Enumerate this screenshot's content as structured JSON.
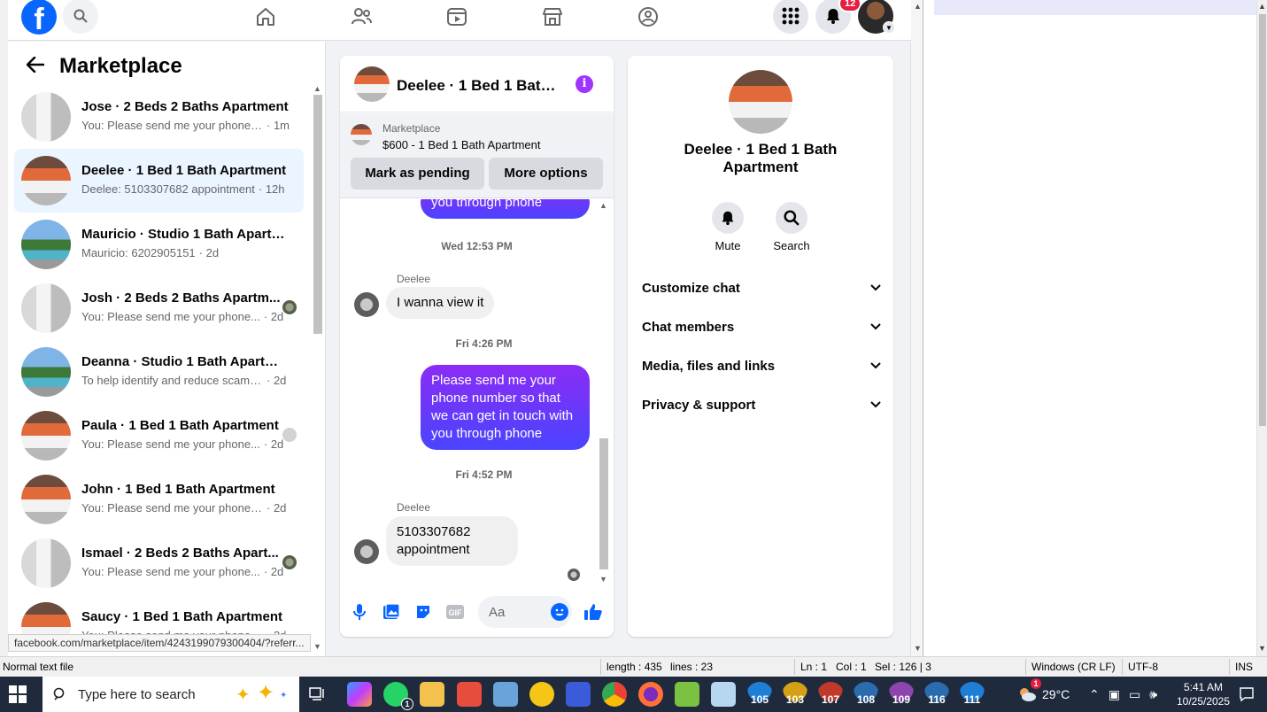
{
  "colors": {
    "fb_blue": "#0866ff",
    "messenger_purple": "#a033ff",
    "active_row": "#ebf5ff",
    "notif_red": "#e41e3f"
  },
  "topnav": {
    "logo": "f",
    "notifications_count": "12",
    "icons": [
      "search-icon",
      "home-icon",
      "friends-icon",
      "video-icon",
      "marketplace-icon",
      "groups-icon",
      "menu-grid-icon",
      "bell-icon"
    ]
  },
  "sidebar": {
    "title": "Marketplace",
    "conversations": [
      {
        "name": "Jose · 2 Beds 2 Baths Apartment",
        "preview": "You: Please send me your phone n...",
        "time": "· 1m",
        "thumb": "room",
        "mini": ""
      },
      {
        "name": "Deelee · 1 Bed 1 Bath Apartment",
        "preview": "Deelee: 5103307682 appointment",
        "time": "· 12h",
        "thumb": "bed",
        "mini": "",
        "active": true
      },
      {
        "name": "Mauricio · Studio 1 Bath Apartm...",
        "preview": "Mauricio: 6202905151",
        "time": "· 2d",
        "thumb": "pool",
        "mini": ""
      },
      {
        "name": "Josh · 2 Beds 2 Baths Apartm...",
        "preview": "You: Please send me your phone...",
        "time": "· 2d",
        "thumb": "room",
        "mini": "photo"
      },
      {
        "name": "Deanna · Studio 1 Bath Apartment",
        "preview": "To help identify and reduce scams ...",
        "time": "· 2d",
        "thumb": "pool",
        "mini": ""
      },
      {
        "name": "Paula · 1 Bed 1 Bath Apartment",
        "preview": "You: Please send me your phone...",
        "time": "· 2d",
        "thumb": "bed",
        "mini": "gray"
      },
      {
        "name": "John · 1 Bed 1 Bath Apartment",
        "preview": "You: Please send me your phone n...",
        "time": "· 2d",
        "thumb": "bed",
        "mini": ""
      },
      {
        "name": "Ismael · 2 Beds 2 Baths Apart...",
        "preview": "You: Please send me your phone...",
        "time": "· 2d",
        "thumb": "room",
        "mini": "photo"
      },
      {
        "name": "Saucy · 1 Bed 1 Bath Apartment",
        "preview": "You: Please send me your phone n...",
        "time": "· 2d",
        "thumb": "bed",
        "mini": ""
      }
    ]
  },
  "status_url": "facebook.com/marketplace/item/4243199079300404/?referr...",
  "chat": {
    "title": "Deelee · 1 Bed 1 Bath Apartment",
    "marketplace_label": "Marketplace",
    "listing": "$600 - 1 Bed 1 Bath Apartment",
    "mark_pending": "Mark as pending",
    "more_options": "More options",
    "messages": {
      "partial_out": "you through phone",
      "ts1": "Wed 12:53 PM",
      "sender1": "Deelee",
      "in1": "I wanna view it",
      "ts2": "Fri 4:26 PM",
      "out1": "Please send me your phone  number so that we can get in touch with you through phone",
      "ts3": "Fri 4:52 PM",
      "sender2": "Deelee",
      "in2": "5103307682 appointment"
    },
    "composer_placeholder": "Aa"
  },
  "info": {
    "name": "Deelee · 1 Bed 1 Bath Apartment",
    "actions": {
      "mute": "Mute",
      "search": "Search"
    },
    "sections": [
      "Customize chat",
      "Chat members",
      "Media, files and links",
      "Privacy & support"
    ]
  },
  "notepad_status": {
    "type": "Normal text file",
    "length": "length : 435",
    "lines": "lines : 23",
    "ln": "Ln : 1",
    "col": "Col : 1",
    "sel": "Sel : 126 | 3",
    "eol": "Windows (CR LF)",
    "encoding": "UTF-8",
    "mode": "INS"
  },
  "taskbar": {
    "search_placeholder": "Type here to search",
    "whatsapp_badge": "1",
    "numbered_apps": [
      "105",
      "103",
      "107",
      "108",
      "109",
      "116",
      "111"
    ],
    "weather": "29°C",
    "weather_badge": "1",
    "time": "5:41 AM",
    "date": "10/25/2025"
  }
}
